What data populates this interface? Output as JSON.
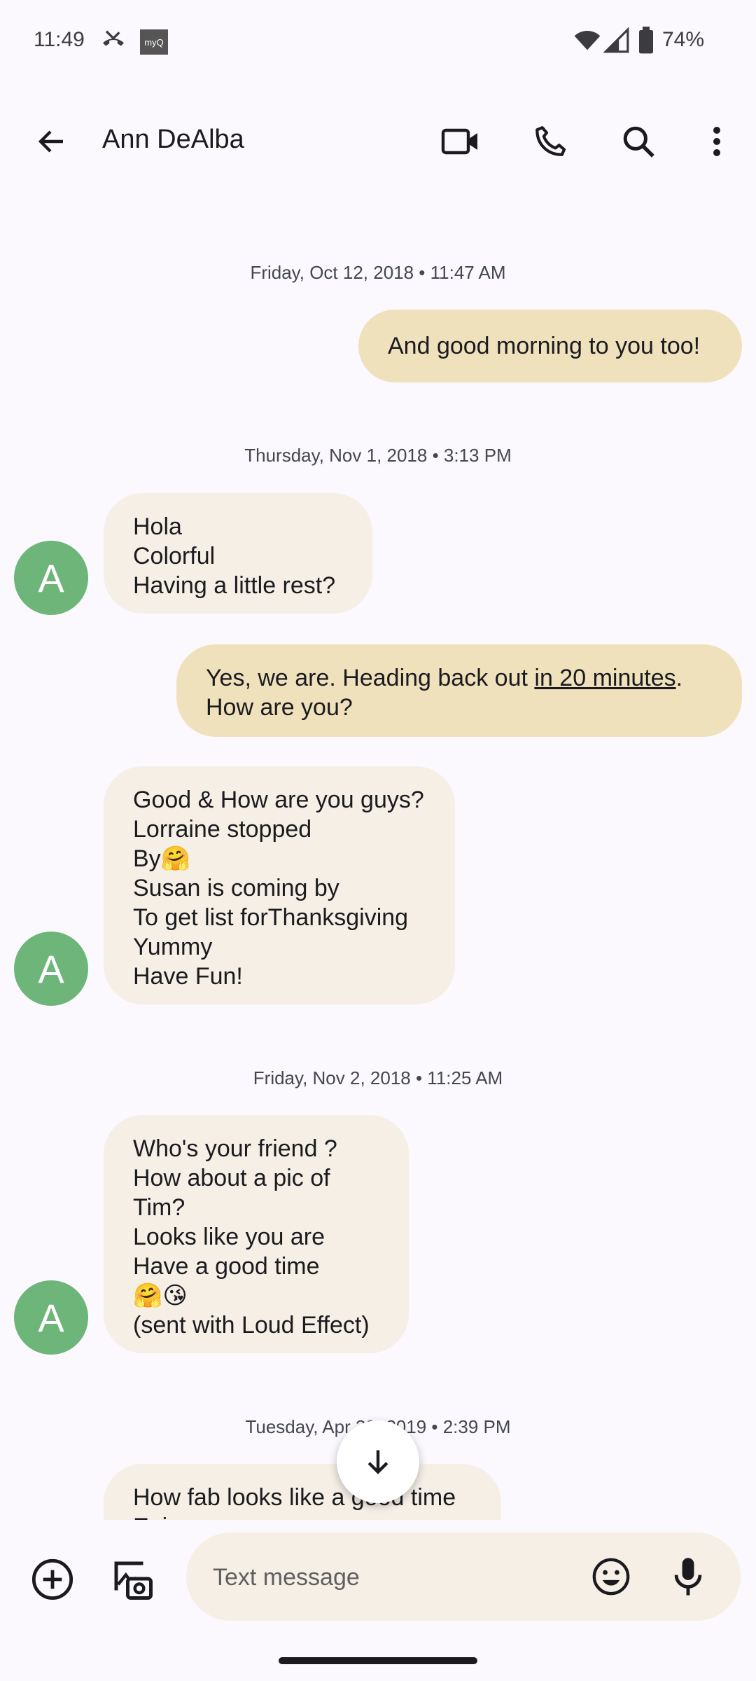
{
  "status": {
    "time": "11:49",
    "battery": "74%",
    "notif_label": "myQ"
  },
  "header": {
    "contact_name": "Ann DeAlba"
  },
  "conversation": {
    "dates": [
      "Friday, Oct 12, 2018 • 11:47 AM",
      "Thursday, Nov 1, 2018 • 3:13 PM",
      "Friday, Nov 2, 2018 • 11:25 AM",
      "Tuesday, Apr 30, 2019 • 2:39 PM"
    ],
    "messages": [
      {
        "direction": "outgoing",
        "text": "And good morning to you too!"
      },
      {
        "direction": "incoming",
        "text": "Hola\nColorful\nHaving a little rest?"
      },
      {
        "direction": "outgoing",
        "text_before": "Yes, we are. Heading back out ",
        "link": "in 20 minutes",
        "text_after": ".\nHow are you?"
      },
      {
        "direction": "incoming",
        "text": "Good & How are you guys?\nLorraine stopped\nBy🤗\nSusan is coming by\nTo get list forThanksgiving\nYummy\nHave Fun!"
      },
      {
        "direction": "incoming",
        "text": "Who's your friend ?\nHow about a pic of\nTim?\nLooks like you are\nHave a good time\n🤗😘\n(sent with Loud Effect)"
      },
      {
        "direction": "incoming",
        "text": "How fab looks like a good time\nEnjoy\nHave"
      }
    ],
    "avatar_letter": "A"
  },
  "composer": {
    "placeholder": "Text message"
  },
  "colors": {
    "outgoing_bubble": "#f0e1bd",
    "incoming_bubble": "#f5efe6",
    "avatar": "#6db579"
  }
}
